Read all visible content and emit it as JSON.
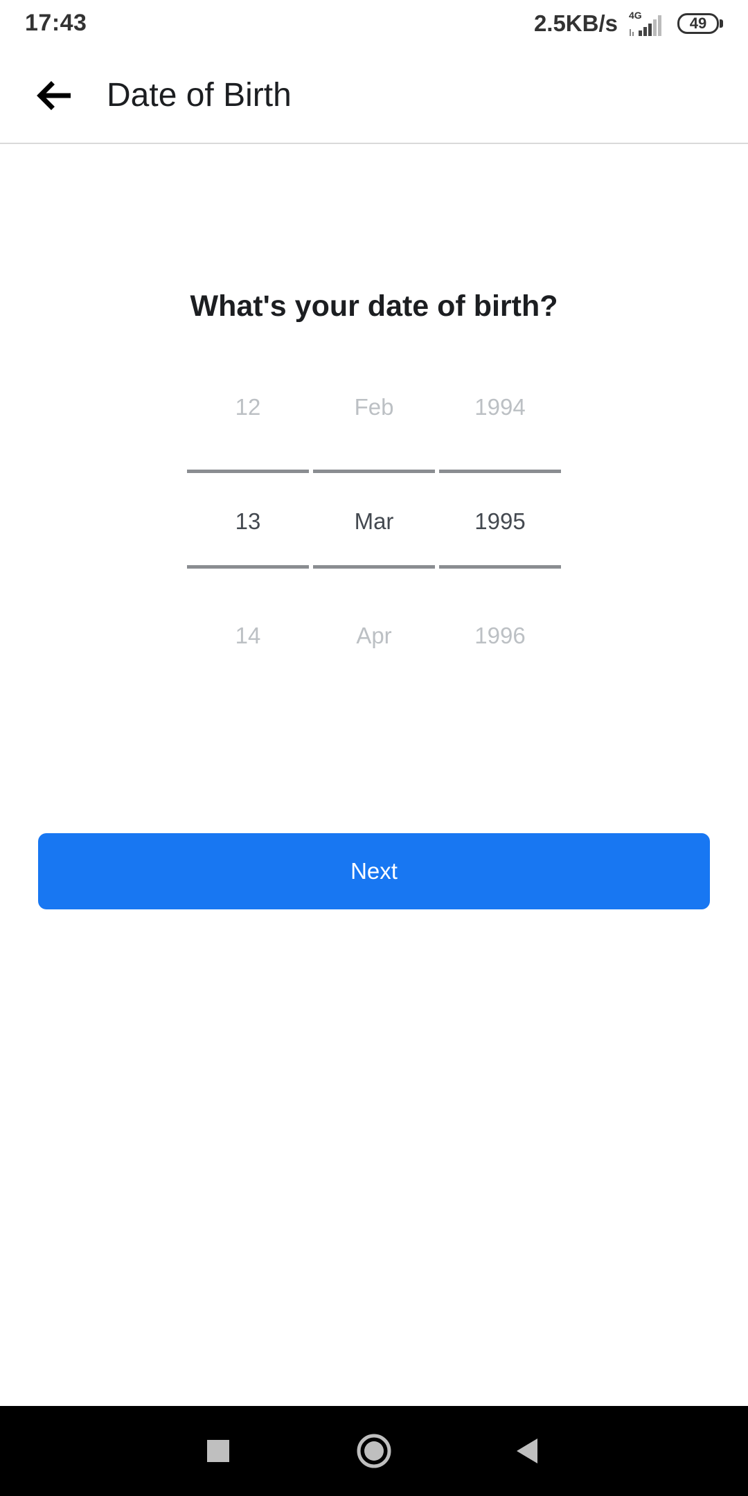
{
  "status_bar": {
    "time": "17:43",
    "network_speed": "2.5KB/s",
    "network_type": "4G",
    "battery_level": "49"
  },
  "app_bar": {
    "title": "Date of Birth",
    "back_icon": "arrow-left-icon"
  },
  "question": "What's your date of birth?",
  "picker": {
    "day": {
      "prev": "12",
      "selected": "13",
      "next": "14"
    },
    "month": {
      "prev": "Feb",
      "selected": "Mar",
      "next": "Apr"
    },
    "year": {
      "prev": "1994",
      "selected": "1995",
      "next": "1996"
    }
  },
  "next_button": {
    "label": "Next"
  },
  "nav_bar": {
    "recents_icon": "square-icon",
    "home_icon": "circle-icon",
    "back_icon": "triangle-back-icon"
  },
  "colors": {
    "accent": "#1877f2",
    "picker_line": "#8a8d91",
    "dim_text": "#bcc0c4",
    "selected_text": "#444950"
  }
}
